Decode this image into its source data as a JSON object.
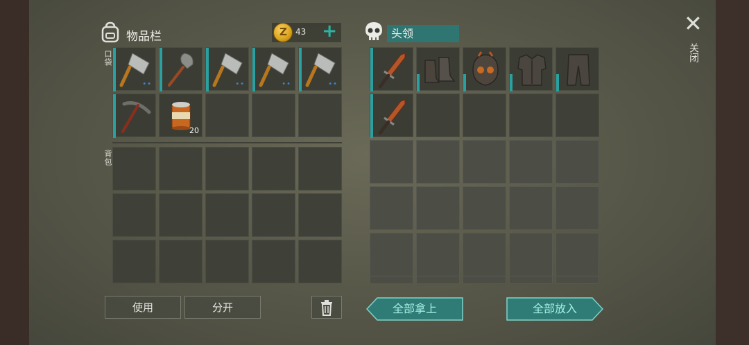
{
  "inventory": {
    "title": "物品栏",
    "coins": "43",
    "plus": "+",
    "pocket_label": "口袋",
    "backpack_label": "背包",
    "pocket_slots": [
      {
        "item": "cleaver-icon",
        "dots": "••"
      },
      {
        "item": "shovel-icon",
        "dots": ""
      },
      {
        "item": "cleaver-icon",
        "dots": "••"
      },
      {
        "item": "cleaver-icon",
        "dots": "••"
      },
      {
        "item": "cleaver-icon",
        "dots": "••"
      },
      {
        "item": "pickaxe-icon",
        "dots": ""
      },
      {
        "item": "food-can-icon",
        "qty": "20"
      }
    ]
  },
  "loot": {
    "name": "头领",
    "slots": [
      {
        "item": "dagger-icon"
      },
      {
        "item": "boots-icon"
      },
      {
        "item": "helmet-icon"
      },
      {
        "item": "chest-armor-icon"
      },
      {
        "item": "leg-armor-icon"
      },
      {
        "item": "dagger-icon"
      }
    ]
  },
  "close_label": "关闭",
  "buttons": {
    "use": "使用",
    "split": "分开",
    "take_all": "全部拿上",
    "put_all": "全部放入"
  }
}
